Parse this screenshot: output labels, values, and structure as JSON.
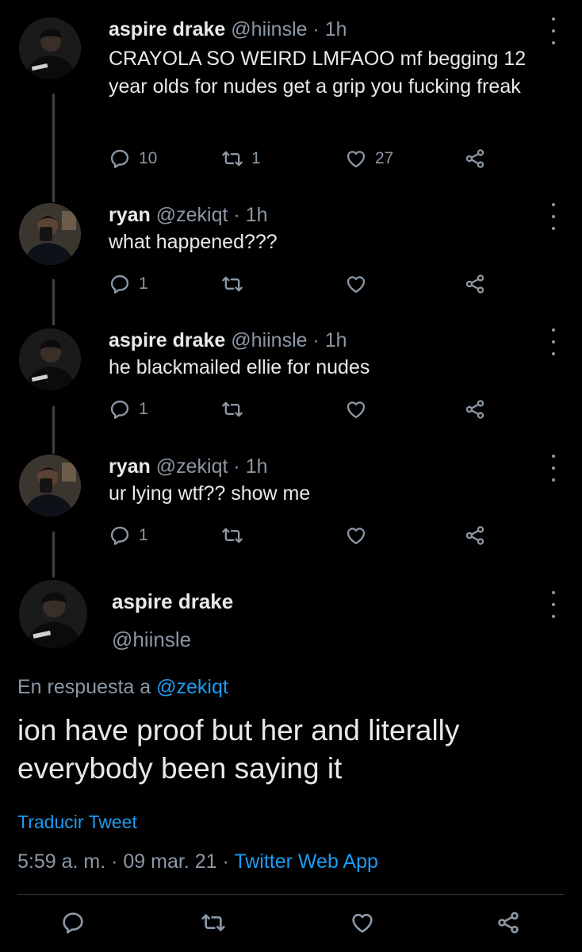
{
  "tweets": [
    {
      "name": "aspire drake",
      "handle": "@hiinsle",
      "separator": "·",
      "time": "1h",
      "text": "CRAYOLA SO WEIRD LMFAOO mf begging 12 year olds for nudes get a grip you fucking freak",
      "replies": "10",
      "retweets": "1",
      "likes": "27",
      "avatar_icon": "avatar-photo-icon"
    },
    {
      "name": "ryan",
      "handle": "@zekiqt",
      "separator": "·",
      "time": "1h",
      "text": "what happened???",
      "replies": "1",
      "retweets": "",
      "likes": "",
      "avatar_icon": "avatar-photo-icon"
    },
    {
      "name": "aspire drake",
      "handle": "@hiinsle",
      "separator": "·",
      "time": "1h",
      "text": "he blackmailed ellie for nudes",
      "replies": "1",
      "retweets": "",
      "likes": "",
      "avatar_icon": "avatar-photo-icon"
    },
    {
      "name": "ryan",
      "handle": "@zekiqt",
      "separator": "·",
      "time": "1h",
      "text": "ur lying wtf?? show me",
      "replies": "1",
      "retweets": "",
      "likes": "",
      "avatar_icon": "avatar-photo-icon"
    }
  ],
  "main_tweet": {
    "name": "aspire drake",
    "handle": "@hiinsle",
    "reply_prefix": "En respuesta a",
    "reply_mention": "@zekiqt",
    "text": "ion have proof but her and literally everybody been saying it",
    "translate_label": "Traducir Tweet",
    "time": "5:59 a. m.",
    "separator": "·",
    "date": "09 mar. 21",
    "app": "Twitter Web App"
  },
  "icons": {
    "reply": "reply-icon",
    "retweet": "retweet-icon",
    "like": "heart-icon",
    "share": "share-icon",
    "more": "more-vertical-icon"
  },
  "colors": {
    "background": "#000000",
    "text": "#e7e9ea",
    "muted": "#8b98a5",
    "link": "#1d9bf0",
    "thread_line": "#3d4043"
  }
}
